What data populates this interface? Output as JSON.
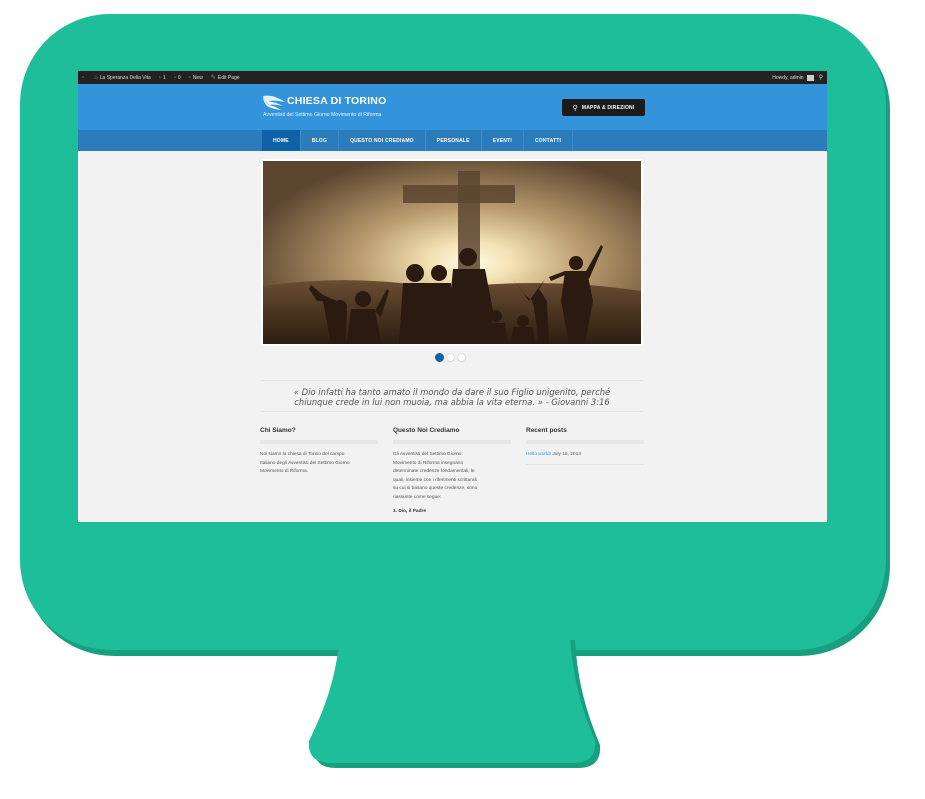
{
  "admin_bar": {
    "site_name": "La Speranza Della Vita",
    "updates_count": "1",
    "comments_count": "0",
    "new_label": "New",
    "edit_label": "Edit Page",
    "greeting": "Howdy, admin"
  },
  "header": {
    "title": "CHIESA DI TORINO",
    "tagline": "Avventisti del Settimo Giorno Movimento di Riforma",
    "map_button": "MAPPA & DIREZIONI"
  },
  "nav": {
    "items": [
      {
        "label": "HOME"
      },
      {
        "label": "BLOG"
      },
      {
        "label": "QUESTO NOI CREDIAMO"
      },
      {
        "label": "PERSONALE"
      },
      {
        "label": "EVENTI"
      },
      {
        "label": "CONTATTI"
      }
    ]
  },
  "slider": {
    "slide_count": 3,
    "active_index": 0
  },
  "quote": {
    "line1": "« Dio infatti ha tanto amato il mondo da dare il suo Figlio unigenito, perché",
    "line2": "chiunque crede in lui non muoia, ma abbia la vita eterna. » - Giovanni 3:16"
  },
  "widgets": {
    "chi_siamo": {
      "title": "Chi Siamo?",
      "text": [
        "Noi siamo la chiesa di Torino del campo",
        "Italiano degli Avventisti del Settimo Giorno",
        "Movimento di Riforma."
      ]
    },
    "questo": {
      "title": "Questo Noi Crediamo",
      "text": [
        "Gli Avventisti del Settimo Giorno",
        "Movimento di Riforma insegnano",
        "determinate credenze fondamentali, le",
        "quali, insieme con i riferimenti scritturali",
        "su cui si basano queste credenze, sono",
        "riassunte come segue:"
      ],
      "heading": "1. Dio, il Padre"
    },
    "recent": {
      "title": "Recent posts",
      "link": "Hello world!",
      "date": " July 16, 2013"
    }
  },
  "colors": {
    "frame": "#1dbe99",
    "header": "#3394dc",
    "nav": "#2a7dba",
    "nav_active": "#1062a8",
    "admin_bar": "#222222"
  }
}
